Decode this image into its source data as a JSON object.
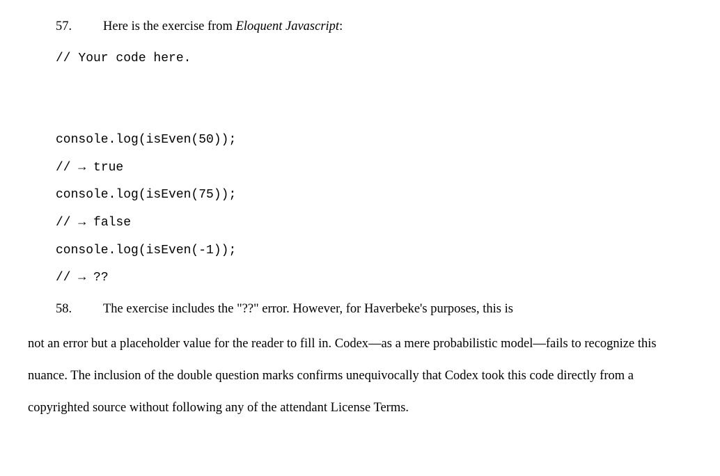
{
  "paragraphs": {
    "p57": {
      "number": "57.",
      "text_before_italic": "Here is the exercise from ",
      "italic_text": "Eloquent Javascript",
      "text_after_italic": ":"
    },
    "p58": {
      "number": "58.",
      "first_line": "The exercise includes the \"??\" error. However, for Haverbeke's purposes, this is",
      "continuation": "not an error but a placeholder value for the reader to fill in. Codex—as a mere probabilistic model—fails to recognize this nuance. The inclusion of the double question marks confirms unequivocally that Codex took this code directly from a copyrighted source without following any of the attendant License Terms."
    }
  },
  "code": {
    "line1": "// Your code here.",
    "line2": "console.log(isEven(50));",
    "line3_prefix": "// ",
    "line3_arrow": "→",
    "line3_suffix": " true",
    "line4": "console.log(isEven(75));",
    "line5_prefix": "// ",
    "line5_arrow": "→",
    "line5_suffix": " false",
    "line6": "console.log(isEven(-1));",
    "line7_prefix": "// ",
    "line7_arrow": "→",
    "line7_suffix": " ??"
  }
}
